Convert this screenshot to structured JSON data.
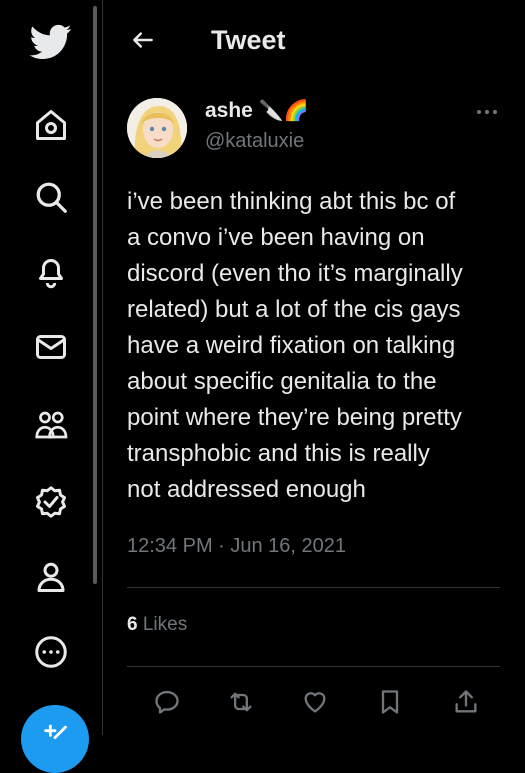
{
  "header": {
    "title": "Tweet"
  },
  "icons": {
    "logo": "twitter-bird-icon",
    "home": "home-icon",
    "explore": "search-icon",
    "notifications": "bell-icon",
    "messages": "mail-icon",
    "communities": "people-icon",
    "verified": "verified-badge-icon",
    "profile": "person-icon",
    "more": "more-circle-icon",
    "compose": "compose-icon"
  },
  "tweet": {
    "author_name": "ashe",
    "author_emoji": "🔪🌈",
    "author_handle": "@kataluxie",
    "text": "i’ve been thinking abt this bc of\na convo i’ve been having on\ndiscord (even tho it’s marginally\nrelated) but a lot of the cis gays\nhave a weird fixation on talking\nabout specific genitalia to the\npoint where they’re being pretty\ntransphobic and this is really\nnot addressed enough",
    "timestamp": "12:34 PM · Jun 16, 2021",
    "likes_count": "6",
    "likes_label": "Likes"
  },
  "colors": {
    "background": "#000000",
    "text": "#e7e9ea",
    "secondary": "#71767b",
    "accent": "#1d9bf0",
    "border": "#2f3336"
  }
}
